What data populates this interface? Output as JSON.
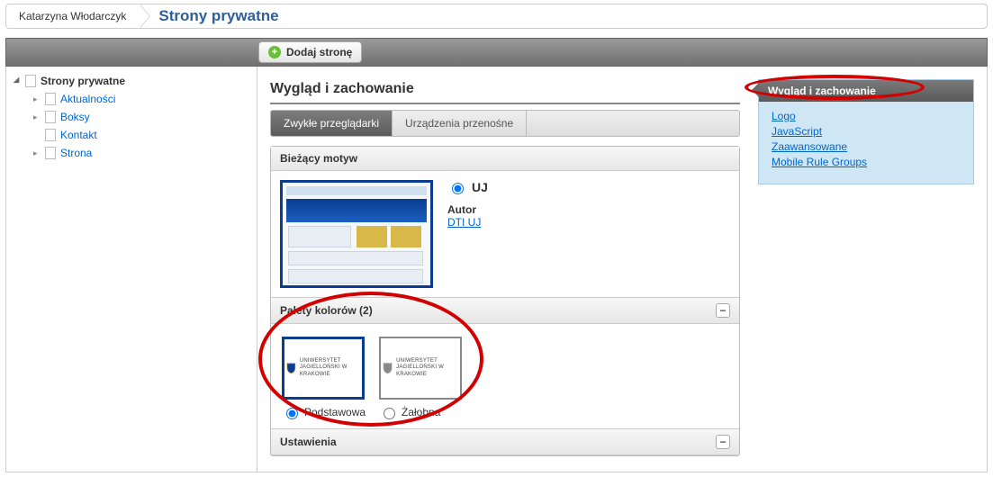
{
  "breadcrumb": {
    "user": "Katarzyna Włodarczyk",
    "page": "Strony prywatne"
  },
  "toolbar": {
    "add_page": "Dodaj stronę"
  },
  "sidebar": {
    "root": "Strony prywatne",
    "items": [
      {
        "label": "Aktualności",
        "expandable": true
      },
      {
        "label": "Boksy",
        "expandable": true
      },
      {
        "label": "Kontakt",
        "expandable": false
      },
      {
        "label": "Strona",
        "expandable": true
      }
    ]
  },
  "main": {
    "title": "Wygląd i zachowanie",
    "tabs": {
      "standard": "Zwykłe przeglądarki",
      "mobile": "Urządzenia przenośne"
    },
    "current_theme": {
      "header": "Bieżący motyw",
      "name": "UJ",
      "author_label": "Autor",
      "author": "DTI UJ"
    },
    "palettes": {
      "header": "Palety kolorów (2)",
      "logo_text": "UNIWERSYTET JAGIELLOŃSKI W KRAKOWIE",
      "items": [
        {
          "label": "Podstawowa",
          "selected": true
        },
        {
          "label": "Żałobna",
          "selected": false
        }
      ]
    },
    "settings_header": "Ustawienia"
  },
  "side_panel": {
    "header": "Wygląd i zachowanie",
    "items": [
      "Logo",
      "JavaScript",
      "Zaawansowane",
      "Mobile Rule Groups"
    ]
  }
}
